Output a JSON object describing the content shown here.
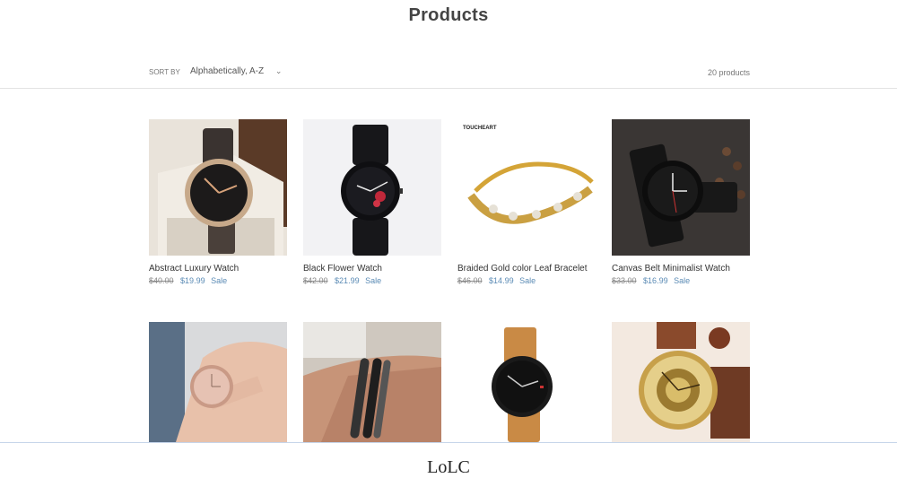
{
  "page": {
    "title": "Products"
  },
  "toolbar": {
    "sort_label": "SORT BY",
    "sort_value": "Alphabetically, A-Z",
    "product_count": "20 products"
  },
  "products": [
    {
      "name": "Abstract Luxury Watch",
      "price": "$40.00",
      "sale_price": "$19.99",
      "sale_badge": "Sale"
    },
    {
      "name": "Black Flower Watch",
      "price": "$42.00",
      "sale_price": "$21.99",
      "sale_badge": "Sale"
    },
    {
      "name": "Braided Gold color Leaf Bracelet",
      "price": "$46.00",
      "sale_price": "$14.99",
      "sale_badge": "Sale",
      "image_brand": "TOUCHEART"
    },
    {
      "name": "Canvas Belt Minimalist Watch",
      "price": "$33.00",
      "sale_price": "$16.99",
      "sale_badge": "Sale"
    },
    {
      "name": "",
      "price": "",
      "sale_price": "",
      "sale_badge": ""
    },
    {
      "name": "",
      "price": "",
      "sale_price": "",
      "sale_badge": ""
    },
    {
      "name": "",
      "price": "",
      "sale_price": "",
      "sale_badge": ""
    },
    {
      "name": "",
      "price": "",
      "sale_price": "",
      "sale_badge": ""
    }
  ],
  "footer": {
    "partial_heading": "LoLC"
  },
  "colors": {
    "sale_blue": "#5b8bb5",
    "divider": "#e3e3e3"
  }
}
